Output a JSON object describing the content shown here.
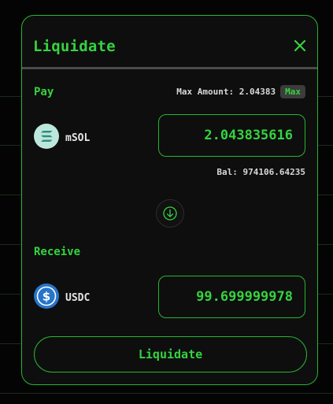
{
  "modal": {
    "title": "Liquidate",
    "close_icon": "close-icon"
  },
  "pay": {
    "label": "Pay",
    "max_amount_label": "Max Amount: 2.04383",
    "max_button": "Max",
    "token": "mSOL",
    "token_icon": "msol-logo-icon",
    "amount": "2.043835616",
    "balance": "Bal: 974106.64235"
  },
  "swap_icon": "arrow-down-icon",
  "receive": {
    "label": "Receive",
    "token": "USDC",
    "token_icon": "usdc-logo-icon",
    "amount": "99.699999978"
  },
  "action": {
    "label": "Liquidate"
  },
  "colors": {
    "accent": "#35d33f",
    "border": "#27b532",
    "panel": "#0e0e0e",
    "usdc": "#2775ca",
    "msol": "#bde7dc"
  }
}
